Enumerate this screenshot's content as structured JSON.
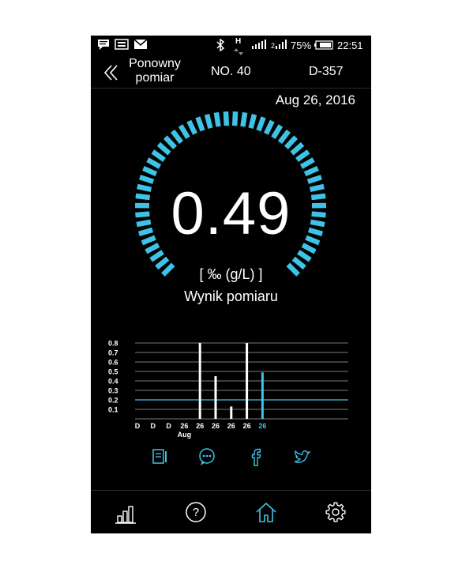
{
  "status_bar": {
    "battery": "75%",
    "time": "22:51",
    "network": "H",
    "icons": [
      "chat-icon",
      "keyboard-icon",
      "mail-icon",
      "bluetooth-icon",
      "signal-icon",
      "signal-icon-2",
      "battery-icon"
    ]
  },
  "header": {
    "back_label_line1": "Ponowny",
    "back_label_line2": "pomiar",
    "no": "NO. 40",
    "device": "D-357"
  },
  "date": "Aug 26, 2016",
  "reading": {
    "value": "0.49",
    "unit": "[ ‰ (g/L) ]",
    "label": "Wynik pomiaru",
    "gauge_fill": 1.0
  },
  "chart_data": {
    "type": "bar",
    "ylim": [
      0,
      0.85
    ],
    "yticks": [
      "0.8",
      "0.7",
      "0.6",
      "0.5",
      "0.4",
      "0.3",
      "0.2",
      "0.1"
    ],
    "categories": [
      "D",
      "D",
      "D",
      "26",
      "26",
      "26",
      "26",
      "26",
      "26"
    ],
    "x_sublabel": "Aug",
    "values": [
      0,
      0,
      0,
      0,
      0.8,
      0.45,
      0.13,
      0.8,
      0.49
    ],
    "highlight_index": 8,
    "threshold": 0.2,
    "colors": {
      "bar": "#ffffff",
      "highlight": "#3ec2e6",
      "grid": "#7a7a7a"
    }
  },
  "share_icons": [
    "notes-icon",
    "chat-bubble-icon",
    "facebook-icon",
    "twitter-icon"
  ],
  "bottom_nav": [
    "stats-icon",
    "help-icon",
    "home-icon",
    "settings-icon"
  ],
  "colors": {
    "accent": "#3ec2e6",
    "background": "#000000",
    "text": "#ffffff"
  }
}
